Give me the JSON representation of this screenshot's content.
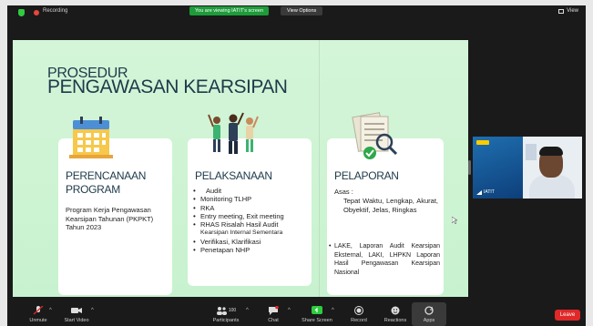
{
  "topbar": {
    "recording_label": "Recording",
    "viewing_banner": "You are viewing IATIT's screen",
    "view_options": "View Options",
    "view_button": "View"
  },
  "slide": {
    "title_line1": "PROSEDUR",
    "title_line2": "PENGAWASAN KEARSIPAN",
    "cards": [
      {
        "title": "PERENCANAAN PROGRAM",
        "text": "Program Kerja Pengawasan Kearsipan Tahunan (PKPKT) Tahun 2023"
      },
      {
        "title": "PELAKSANAAN",
        "items": [
          "Audit",
          "Monitoring TLHP",
          "RKA",
          "Entry meeting, Exit meeting",
          "RHAS Risalah Hasil Audit"
        ],
        "sub_item": "Kearsipan Internal Sementara",
        "items2": [
          "Verifikasi, Klarifikasi",
          "Penetapan NHP"
        ]
      },
      {
        "title": "PELAPORAN",
        "asas_label": "Asas :",
        "asas_text": "Tepat Waktu, Lengkap, Akurat, Obyektif, Jelas, Ringkas",
        "report_text": "LAKE, Laporan Audit Kearsipan Eksternal, LAKI, LHPKN Laporan Hasil Pengawasan Kearsipan Nasional"
      }
    ]
  },
  "video_tile": {
    "participant_name": "IATIT"
  },
  "toolbar": {
    "unmute": "Unmute",
    "start_video": "Start Video",
    "participants": "Participants",
    "participants_count": "100",
    "chat": "Chat",
    "share_screen": "Share Screen",
    "record": "Record",
    "reactions": "Reactions",
    "apps": "Apps",
    "leave": "Leave"
  },
  "colors": {
    "slide_bg": "#c8f2cf",
    "title": "#1d3a4a",
    "banner": "#1e9b3a",
    "leave": "#e02828"
  }
}
